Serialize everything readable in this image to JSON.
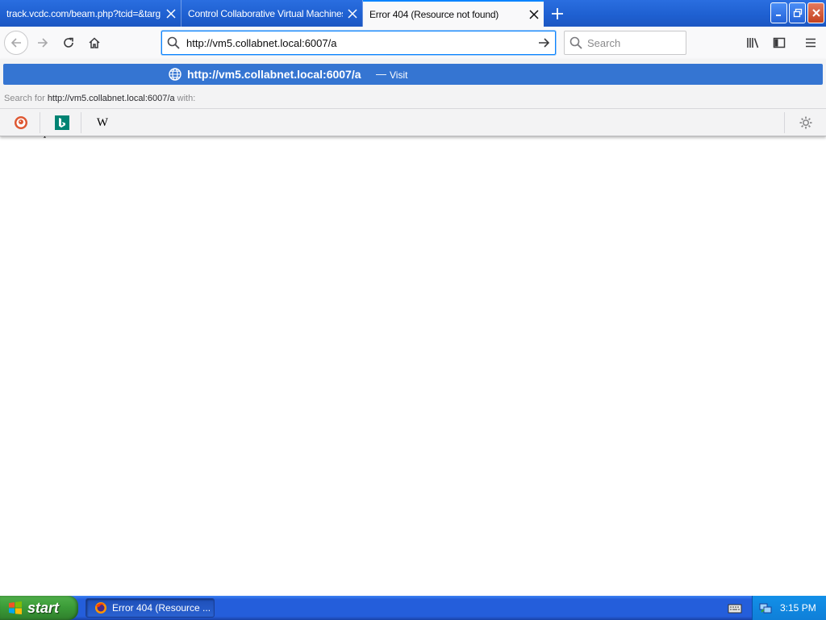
{
  "tabs": [
    {
      "title": "track.vcdc.com/beam.php?tcid=&targ",
      "active": false
    },
    {
      "title": "Control Collaborative Virtual Machines!",
      "active": false
    },
    {
      "title": "Error 404 (Resource not found)",
      "active": true
    }
  ],
  "navbar": {
    "url": "http://vm5.collabnet.local:6007/a",
    "search_placeholder": "Search"
  },
  "popup": {
    "result_url": "http://vm5.collabnet.local:6007/a",
    "result_separator": "—",
    "result_action": "Visit",
    "search_prefix": "Search for",
    "search_query": "http://vm5.collabnet.local:6007/a",
    "search_suffix": "with:",
    "engines": [
      "duckduckgo-icon",
      "bing-icon",
      "wikipedia-icon"
    ],
    "wiki_glyph": "W"
  },
  "page": {
    "partial_text": "The requested URL /a was not found on this server."
  },
  "taskbar": {
    "start_label": "start",
    "task_label": "Error 404 (Resource ...",
    "clock": "3:15 PM"
  },
  "colors": {
    "accent": "#0a84ff",
    "result_highlight": "#3575d2",
    "xp_taskbar": "#245edb",
    "xp_start": "#3a9a37"
  }
}
